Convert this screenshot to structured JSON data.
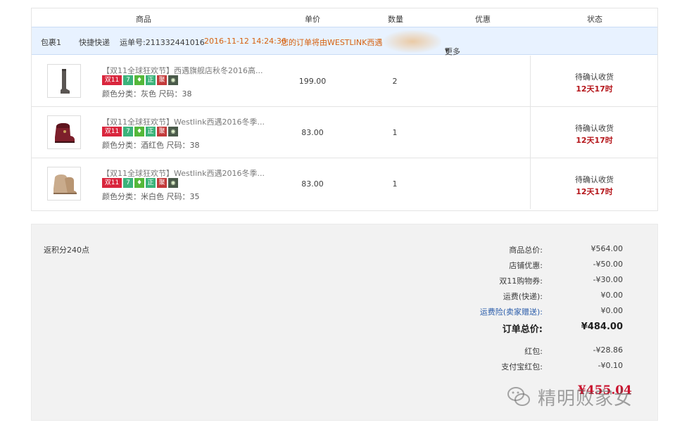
{
  "table_header": {
    "product": "商品",
    "unit_price": "单价",
    "quantity": "数量",
    "discount": "优惠",
    "status": "状态"
  },
  "package": {
    "name": "包裹1",
    "carrier": "快捷快递",
    "tracking": "运单号:211332441016",
    "timestamp": "2016-11-12 14:24:36",
    "message": "您的订单将由WESTLINK西遇",
    "more": "更多",
    "more_icon": "▾"
  },
  "items": [
    {
      "title": "【双11全球狂欢节】西遇旗舰店秋冬2016高...",
      "attrs": "颜色分类：灰色 尺码：38",
      "price": "199.00",
      "qty": "2",
      "status": "待确认收货",
      "time_left": "12天17时",
      "image": "tall-gray-boot"
    },
    {
      "title": "【双11全球狂欢节】Westlink西遇2016冬季...",
      "attrs": "颜色分类：酒红色 尺码：38",
      "price": "83.00",
      "qty": "1",
      "status": "待确认收货",
      "time_left": "12天17时",
      "image": "wine-red-snow-boot"
    },
    {
      "title": "【双11全球狂欢节】Westlink西遇2016冬季...",
      "attrs": "颜色分类：米白色 尺码：35",
      "price": "83.00",
      "qty": "1",
      "status": "待确认收货",
      "time_left": "12天17时",
      "image": "beige-snow-boot"
    }
  ],
  "tags": {
    "double11": "双11",
    "seven": "7",
    "zheng": "正",
    "ju": "聚"
  },
  "summary": {
    "points": "返积分240点",
    "rows": [
      {
        "label": "商品总价:",
        "value": "¥564.00"
      },
      {
        "label": "店铺优惠:",
        "value": "-¥50.00"
      },
      {
        "label": "双11购物券:",
        "value": "-¥30.00"
      },
      {
        "label": "运费(快递):",
        "value": "¥0.00"
      },
      {
        "label": "运费险(卖家赠送):",
        "value": "¥0.00"
      },
      {
        "label": "订单总价:",
        "value": "¥484.00"
      },
      {
        "label": "红包:",
        "value": "-¥28.86"
      },
      {
        "label": "支付宝红包:",
        "value": "-¥0.10"
      }
    ],
    "final_value": "¥455.04"
  },
  "watermark": {
    "text": "精明败家女",
    "icon": "wechat-icon"
  },
  "colors": {
    "accent_orange": "#d6610f",
    "price_red": "#c9122d",
    "time_red": "#b5161b",
    "link_blue": "#2a5caa",
    "package_bar": "#e8f2ff"
  }
}
